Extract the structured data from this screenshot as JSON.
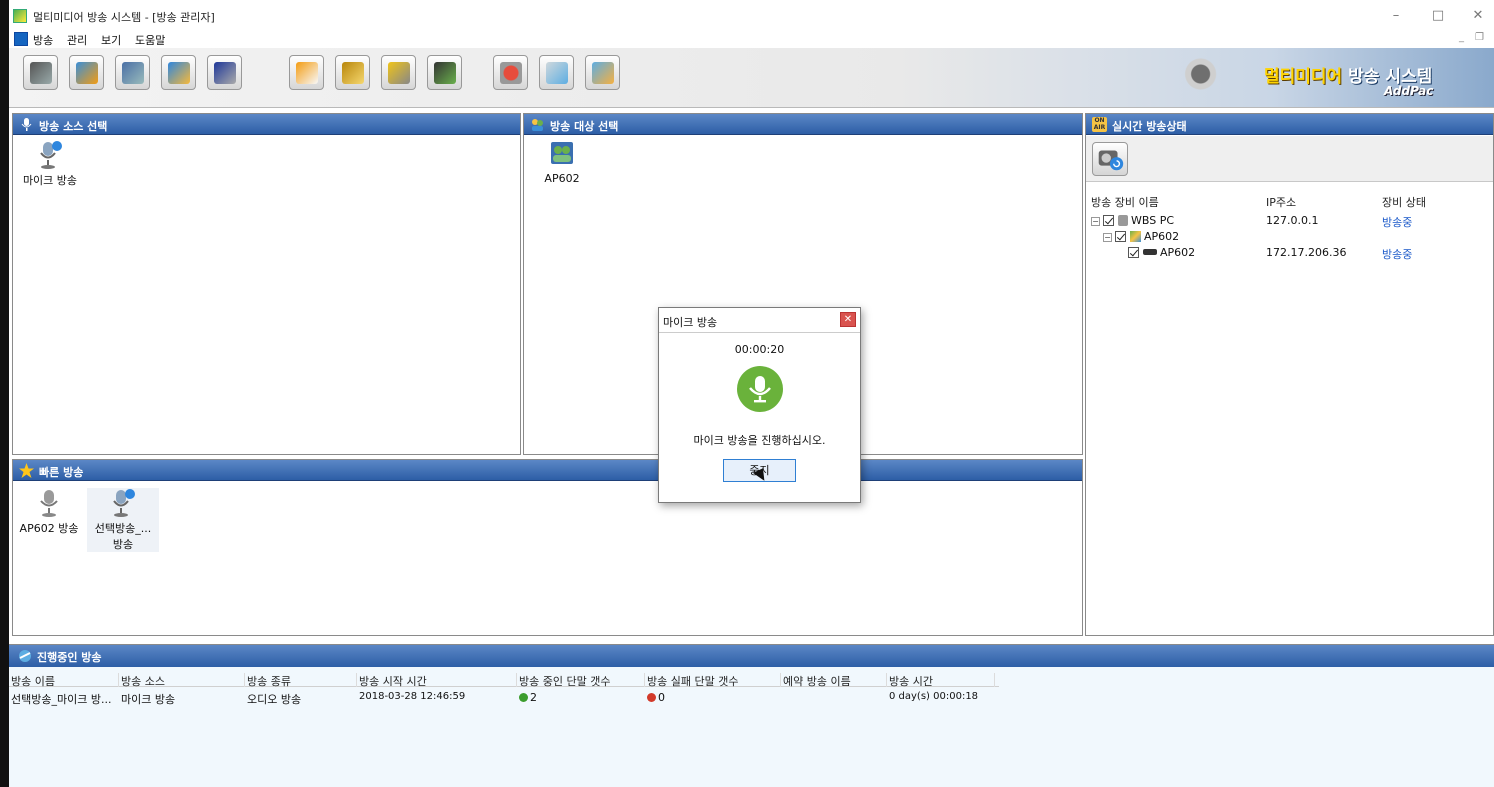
{
  "window": {
    "title": "멀티미디어 방송 시스템 - [방송 관리자]",
    "minimize_icon": "minimize-icon",
    "maximize_icon": "maximize-icon",
    "close_icon": "close-icon"
  },
  "menu": {
    "items": [
      "방송",
      "관리",
      "보기",
      "도움말"
    ]
  },
  "toolbar": {
    "buttons": [
      "toolbar-icon-1",
      "toolbar-icon-2",
      "toolbar-icon-3",
      "toolbar-icon-4",
      "toolbar-icon-5",
      "toolbar-icon-6",
      "toolbar-icon-7",
      "toolbar-icon-8",
      "toolbar-icon-9",
      "toolbar-icon-10",
      "toolbar-icon-11",
      "toolbar-icon-12"
    ],
    "brand_title_1": "멀티미디어",
    "brand_title_2": "방송 시스템",
    "brand_sub": "AddPac"
  },
  "source_panel": {
    "title": "방송 소스 선택",
    "items": [
      {
        "label": "마이크 방송",
        "icon": "microphone-icon"
      }
    ]
  },
  "target_panel": {
    "title": "방송 대상 선택",
    "items": [
      {
        "label": "AP602",
        "icon": "group-icon"
      }
    ]
  },
  "quick_panel": {
    "title": "빠른 방송",
    "items": [
      {
        "label": "AP602 방송",
        "icon": "microphone-icon"
      },
      {
        "label": "선택방송_...",
        "label2": "방송",
        "icon": "microphone-icon"
      }
    ]
  },
  "realtime_panel": {
    "title": "실시간 방송상태",
    "badge": "ON AIR",
    "columns": [
      "방송 장비 이름",
      "IP주소",
      "장비 상태"
    ],
    "rows": [
      {
        "name": "WBS PC",
        "ip": "127.0.0.1",
        "status": "방송중"
      },
      {
        "name": "AP602",
        "ip": "",
        "status": ""
      },
      {
        "name": "AP602",
        "ip": "172.17.206.36",
        "status": "방송중"
      }
    ]
  },
  "active_panel": {
    "title": "진행중인 방송",
    "columns": [
      "방송 이름",
      "방송 소스",
      "방송 종류",
      "방송 시작 시간",
      "방송 중인 단말 갯수",
      "방송 실패 단말 갯수",
      "예약 방송 이름",
      "방송 시간"
    ],
    "row": {
      "name": "선택방송_마이크 방...",
      "source": "마이크 방송",
      "type": "오디오 방송",
      "start": "2018-03-28 12:46:59",
      "active_count": "2",
      "fail_count": "0",
      "reserved": "",
      "duration": "0 day(s) 00:00:18"
    }
  },
  "dialog": {
    "title": "마이크 방송",
    "time": "00:00:20",
    "message": "마이크 방송을 진행하십시오.",
    "button": "중지"
  },
  "colors": {
    "panel_header": "#2d5ea6",
    "status_blue": "#1b59c9",
    "mic_green": "#6ab23b",
    "ok_green": "#3c9d2e",
    "fail_red": "#d23a2a"
  }
}
